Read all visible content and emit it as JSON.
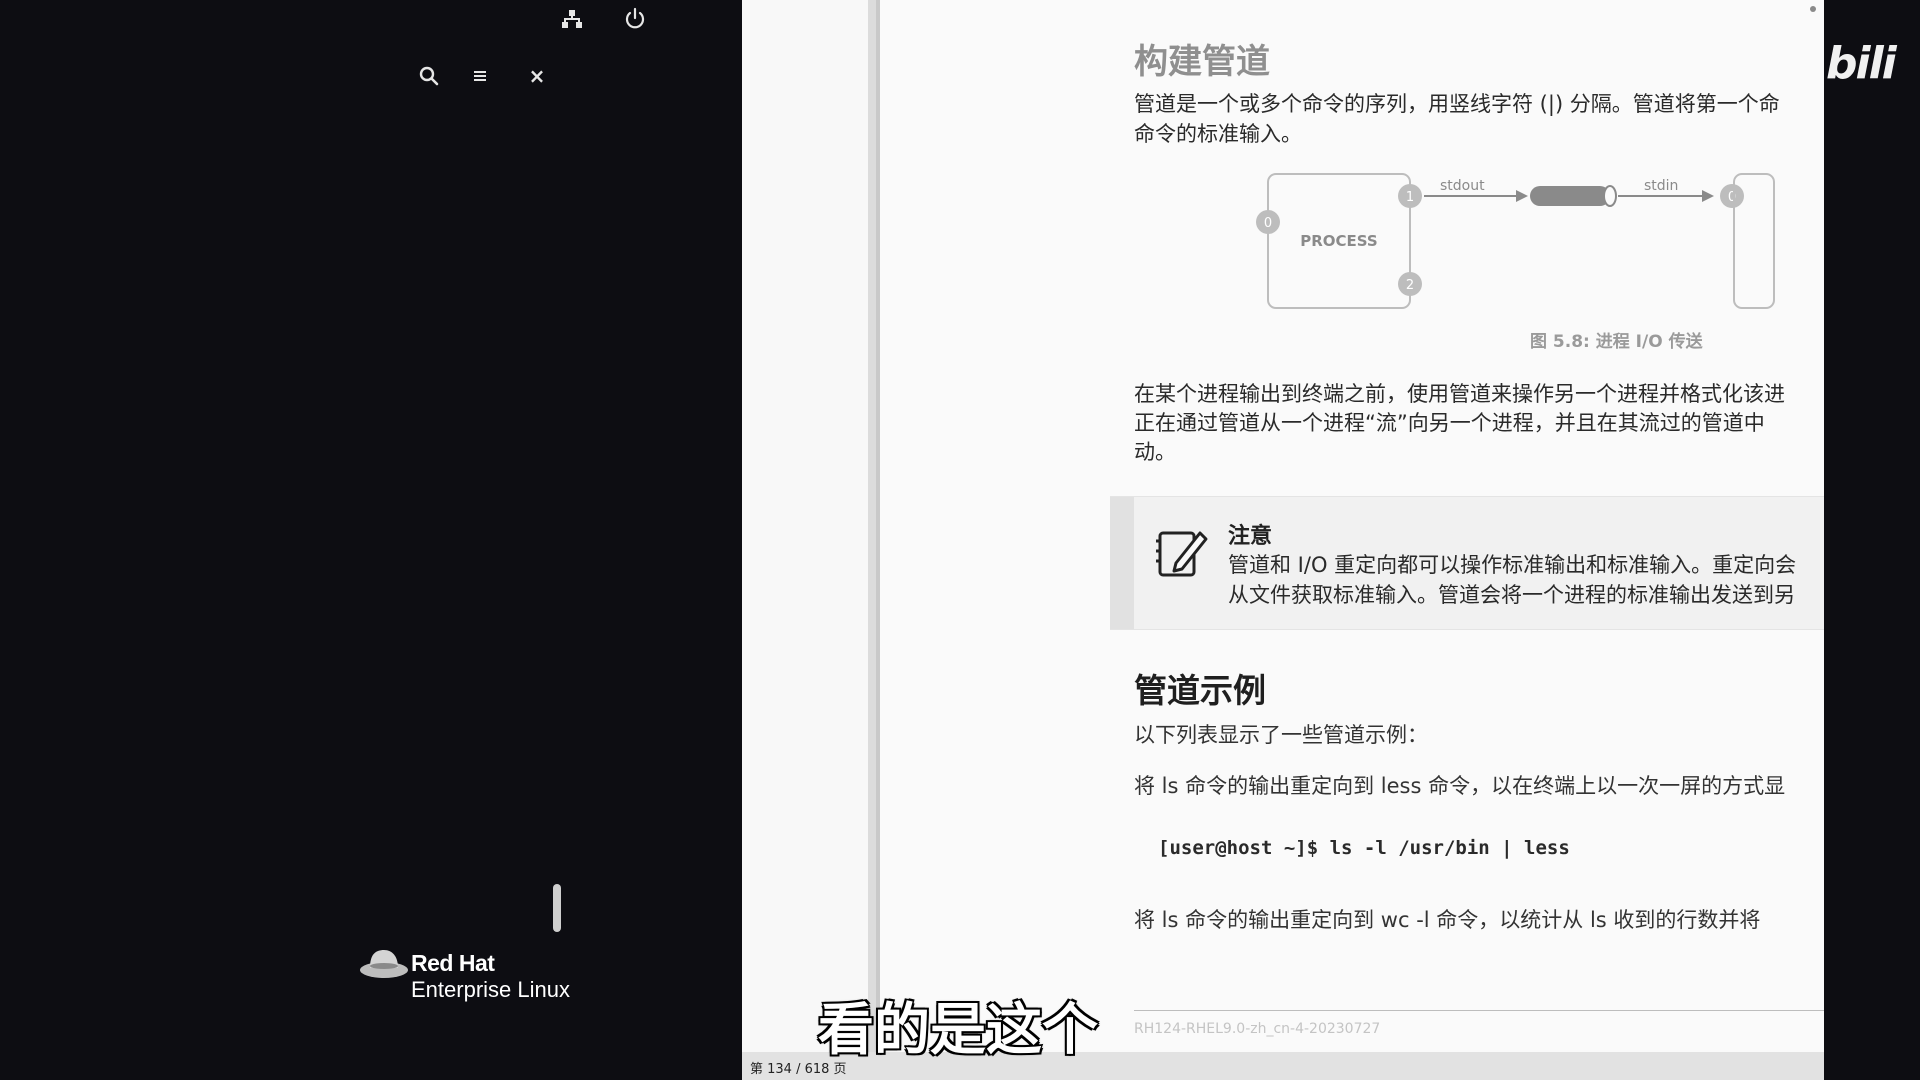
{
  "desktop": {
    "brand": "Red Hat",
    "product": "Enterprise Linux"
  },
  "icons": {
    "network": "network-icon",
    "power": "power-icon",
    "search": "search-icon",
    "menu": "hamburger-menu-icon",
    "close": "close-icon",
    "close_glyph": "×"
  },
  "document": {
    "heading_build": "构建管道",
    "intro_line1": "管道是一个或多个命令的序列，用竖线字符 (|) 分隔。管道将第一个命",
    "intro_line2": "命令的标准输入。",
    "diagram": {
      "process_label": "PROCESS",
      "stdout_label": "stdout",
      "stdin_label": "stdin",
      "fd0": "0",
      "fd1": "1",
      "fd2": "2"
    },
    "figure_caption": "图 5.8: 进程 I/O 传送",
    "stream_line1": "在某个进程输出到终端之前，使用管道来操作另一个进程并格式化该进",
    "stream_line2": "正在通过管道从一个进程“流”向另一个进程，并且在其流过的管道中",
    "stream_line3": "动。",
    "note_title": "注意",
    "note_line1": "管道和 I/O 重定向都可以操作标准输出和标准输入。重定向会",
    "note_line2": "从文件获取标准输入。管道会将一个进程的标准输出发送到另",
    "heading_examples": "管道示例",
    "list_intro": "以下列表显示了一些管道示例：",
    "example1_text": "将 ls 命令的输出重定向到 less 命令，以在终端上以一次一屏的方式显",
    "code1": "[user@host ~]$ ls -l /usr/bin | less",
    "example2_text": "将 ls 命令的输出重定向到 wc -l 命令，以统计从 ls 收到的行数并将",
    "footer": "RH124-RHEL9.0-zh_cn-4-20230727"
  },
  "status_bar": {
    "page_counter": "第 134 / 618 页"
  },
  "subtitle": "看的是这个",
  "watermark": "bili"
}
